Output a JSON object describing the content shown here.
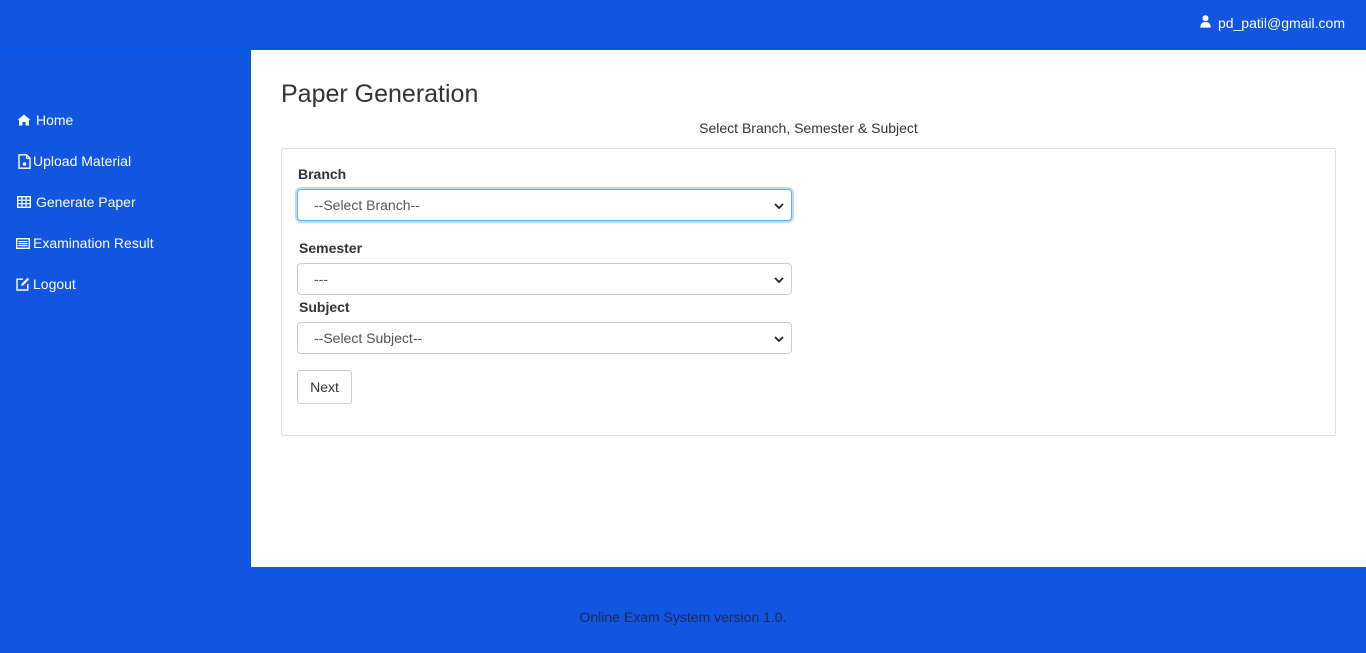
{
  "header": {
    "user_email": "pd_patil@gmail.com",
    "user_icon": "user-icon"
  },
  "sidebar": {
    "items": [
      {
        "label": "Home",
        "icon": "home-icon"
      },
      {
        "label": "Upload Material",
        "icon": "file-icon"
      },
      {
        "label": "Generate Paper",
        "icon": "table-icon"
      },
      {
        "label": "Examination Result",
        "icon": "list-icon"
      },
      {
        "label": "Logout",
        "icon": "edit-icon"
      }
    ]
  },
  "main": {
    "title": "Paper Generation",
    "subtitle": "Select Branch, Semester & Subject",
    "form": {
      "branch_label": "Branch",
      "branch_value": "--Select Branch--",
      "semester_label": "Semester",
      "semester_value": "---",
      "subject_label": "Subject",
      "subject_value": "--Select Subject--",
      "next_label": "Next"
    }
  },
  "footer": {
    "text": "Online Exam System version 1.0."
  },
  "colors": {
    "brand_blue": "#1155e0",
    "focus_border": "#66afe9"
  }
}
